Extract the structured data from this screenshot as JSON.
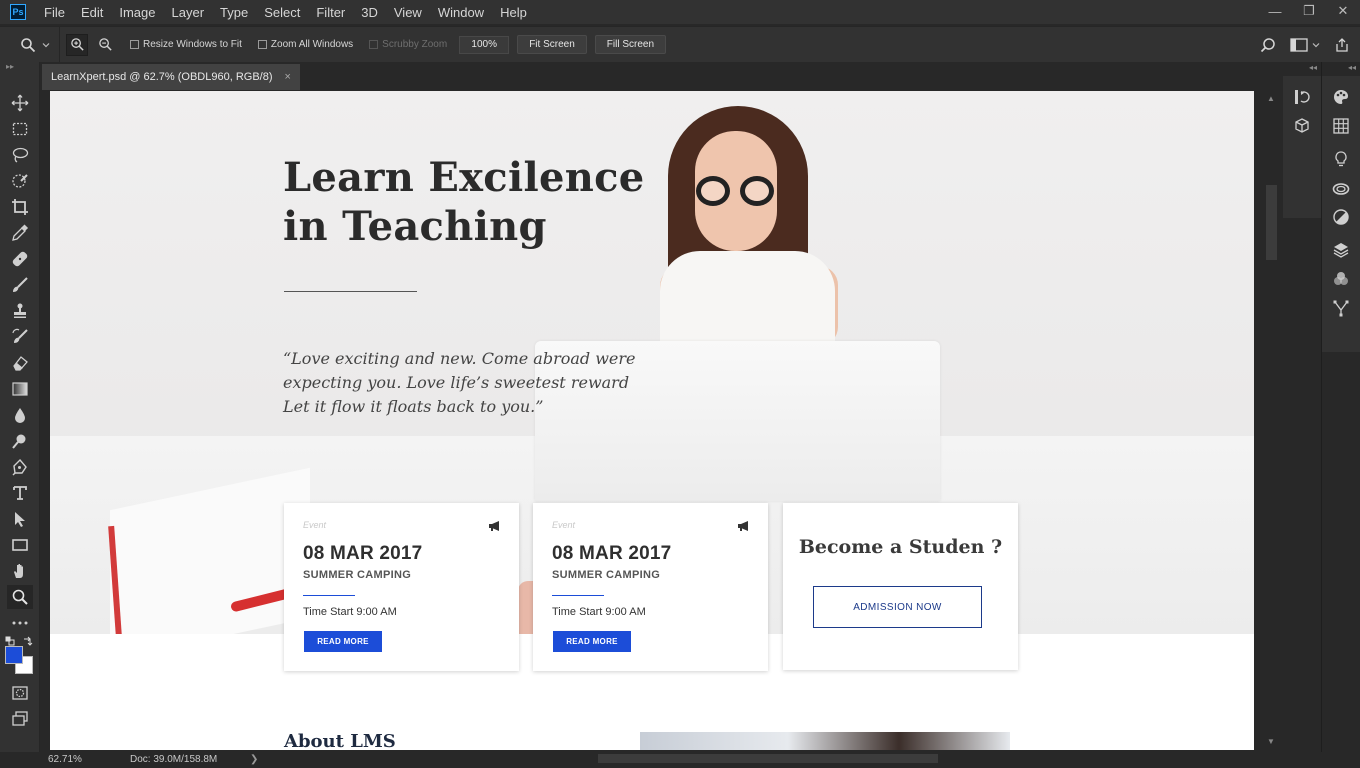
{
  "app": {
    "logo_text": "Ps",
    "menu": [
      "File",
      "Edit",
      "Image",
      "Layer",
      "Type",
      "Select",
      "Filter",
      "3D",
      "View",
      "Window",
      "Help"
    ],
    "window_controls": [
      "—",
      "❐",
      "✕"
    ]
  },
  "options_bar": {
    "resize_windows": "Resize Windows to Fit",
    "zoom_all_windows": "Zoom All Windows",
    "scrubby_zoom": "Scrubby Zoom",
    "zoom_value": "100%",
    "fit_screen": "Fit Screen",
    "fill_screen": "Fill Screen"
  },
  "document": {
    "tab_title": "LearnXpert.psd @ 62.7% (OBDL960, RGB/8)",
    "close_glyph": "×"
  },
  "canvas_content": {
    "hero_title_line1": "Learn Excilence",
    "hero_title_line2": "in Teaching",
    "quote_line1": "“Love exciting and new. Come abroad were",
    "quote_line2": "expecting you. Love life’s sweetest reward",
    "quote_line3": "Let it flow it floats back to you.”",
    "events": [
      {
        "kind": "Event",
        "date": "08 MAR 2017",
        "name": "SUMMER CAMPING",
        "time": "Time Start 9:00 AM",
        "button": "READ MORE"
      },
      {
        "kind": "Event",
        "date": "08 MAR 2017",
        "name": "SUMMER CAMPING",
        "time": "Time Start 9:00 AM",
        "button": "READ MORE"
      }
    ],
    "student_title": "Become a Studen ?",
    "admission_button": "ADMISSION NOW",
    "about_title": "About LMS"
  },
  "status_bar": {
    "zoom": "62.71%",
    "doc_size": "Doc: 39.0M/158.8M",
    "caret": "❯"
  },
  "colors": {
    "accent_blue": "#1c4dd8",
    "foreground_swatch": "#1c4dd8",
    "background_swatch": "#ffffff",
    "ps_logo": "#31a8ff"
  },
  "tools": [
    "move-icon",
    "marquee-icon",
    "lasso-icon",
    "quick-select-icon",
    "crop-icon",
    "eyedropper-icon",
    "healing-icon",
    "brush-icon",
    "stamp-icon",
    "history-brush-icon",
    "eraser-icon",
    "gradient-icon",
    "blur-icon",
    "dodge-icon",
    "pen-icon",
    "type-icon",
    "path-select-icon",
    "rectangle-icon",
    "hand-icon",
    "zoom-icon",
    "more-tools-icon"
  ]
}
